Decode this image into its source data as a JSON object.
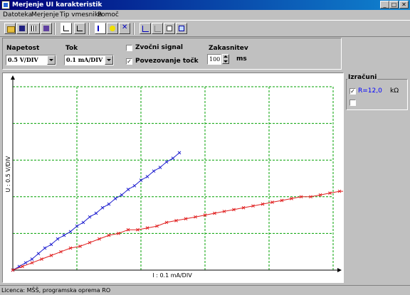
{
  "window": {
    "title": "Merjenje UI karakteristik"
  },
  "menu": [
    "Datoteka",
    "Merjenje",
    "Tip vmesnika",
    "Pomoč"
  ],
  "toolbar": {
    "icons": [
      "open-folder-icon",
      "save-icon",
      "table-icon",
      "door-exit-icon",
      "graph-mode-1-icon",
      "graph-mode-2-icon",
      "measure-start-icon",
      "bulb-icon",
      "clear-points-icon",
      "cursor-tool-1-icon",
      "cursor-tool-2-icon",
      "print-icon",
      "preview-icon"
    ]
  },
  "controls": {
    "napetost_label": "Napetost",
    "napetost_value": "0.5 V/DIV",
    "tok_label": "Tok",
    "tok_value": "0.1 mA/DIV",
    "zvocni_label": "Zvočni signal",
    "zvocni_checked": false,
    "povezovanje_label": "Povezovanje točk",
    "povezovanje_checked": true,
    "zakasnitev_label": "Zakasnitev",
    "zakasnitev_value": "100",
    "zakasnitev_unit": "ms"
  },
  "calc": {
    "title": "Izračuni",
    "r_label": "R=12,0",
    "r_unit": "kΩ",
    "r_checked": true,
    "second_checked": false
  },
  "colors": {
    "grid": "#00a000",
    "series_blue": "#2020d0",
    "series_red": "#e02020",
    "accent_calc": "#0000ff"
  },
  "chart_data": {
    "type": "line",
    "xlabel": "I : 0.1 mA/DIV",
    "ylabel": "U : 0.5 V/DIV",
    "x_divisions": 5,
    "y_divisions": 5,
    "grid": true,
    "series": [
      {
        "color": "blue",
        "x": [
          0.0,
          0.1,
          0.2,
          0.3,
          0.4,
          0.5,
          0.6,
          0.7,
          0.8,
          0.9,
          1.0,
          1.1,
          1.2,
          1.3,
          1.4,
          1.5,
          1.6,
          1.7,
          1.8,
          1.9,
          2.0,
          2.1,
          2.2,
          2.3,
          2.4,
          2.5,
          2.6
        ],
        "y": [
          0.0,
          0.1,
          0.2,
          0.3,
          0.45,
          0.6,
          0.7,
          0.85,
          0.95,
          1.05,
          1.2,
          1.3,
          1.45,
          1.55,
          1.7,
          1.8,
          1.95,
          2.05,
          2.2,
          2.3,
          2.45,
          2.55,
          2.7,
          2.8,
          2.95,
          3.05,
          3.2
        ]
      },
      {
        "color": "red",
        "x": [
          0.0,
          0.15,
          0.3,
          0.45,
          0.6,
          0.75,
          0.9,
          1.05,
          1.2,
          1.35,
          1.5,
          1.65,
          1.8,
          1.95,
          2.1,
          2.25,
          2.4,
          2.55,
          2.7,
          2.85,
          3.0,
          3.15,
          3.3,
          3.45,
          3.6,
          3.75,
          3.9,
          4.05,
          4.2,
          4.35,
          4.5,
          4.65,
          4.8,
          4.95,
          5.1,
          5.25,
          5.4,
          5.55,
          5.7,
          5.85,
          6.0,
          6.15,
          6.3,
          6.45,
          6.6,
          6.75,
          6.9,
          7.05,
          7.2,
          7.35,
          7.5,
          7.65,
          7.8,
          7.95,
          8.1,
          8.25,
          8.4,
          8.55,
          8.7,
          8.85,
          9.0,
          9.15
        ],
        "y": [
          0.0,
          0.1,
          0.2,
          0.3,
          0.4,
          0.5,
          0.6,
          0.65,
          0.75,
          0.85,
          0.95,
          1.0,
          1.1,
          1.1,
          1.15,
          1.2,
          1.3,
          1.35,
          1.4,
          1.45,
          1.5,
          1.55,
          1.6,
          1.65,
          1.7,
          1.75,
          1.8,
          1.85,
          1.9,
          1.95,
          2.0,
          2.0,
          2.05,
          2.1,
          2.15,
          2.15,
          2.2,
          2.25,
          2.3,
          2.3,
          2.35,
          2.35,
          2.4,
          2.45,
          2.45,
          2.5,
          2.55,
          2.55,
          2.6,
          2.6,
          2.65,
          2.7,
          2.7,
          2.75,
          2.8,
          2.8,
          2.85,
          2.85,
          2.9,
          2.95,
          2.95,
          2.95
        ]
      }
    ]
  },
  "status": {
    "text": "Licenca: MŠŠ, programska oprema RO"
  }
}
